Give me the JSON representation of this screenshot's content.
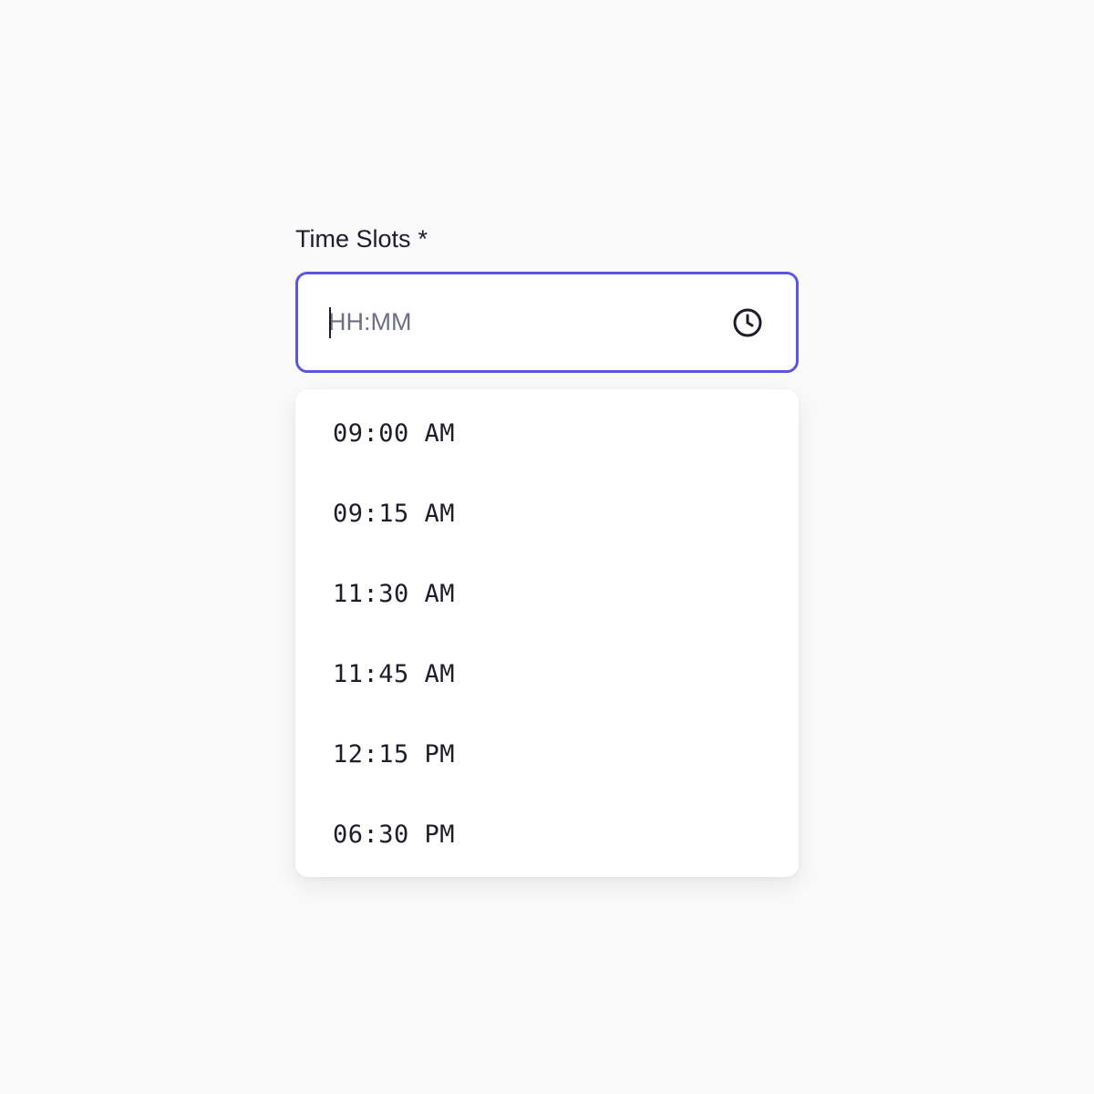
{
  "field": {
    "label": "Time Slots",
    "required_marker": "*",
    "placeholder": "HH:MM",
    "value": "",
    "icon": "clock-icon",
    "accent_color": "#5a56e0"
  },
  "options": [
    {
      "label": "09:00 AM"
    },
    {
      "label": "09:15 AM"
    },
    {
      "label": "11:30 AM"
    },
    {
      "label": "11:45 AM"
    },
    {
      "label": "12:15 PM"
    },
    {
      "label": "06:30 PM"
    }
  ]
}
